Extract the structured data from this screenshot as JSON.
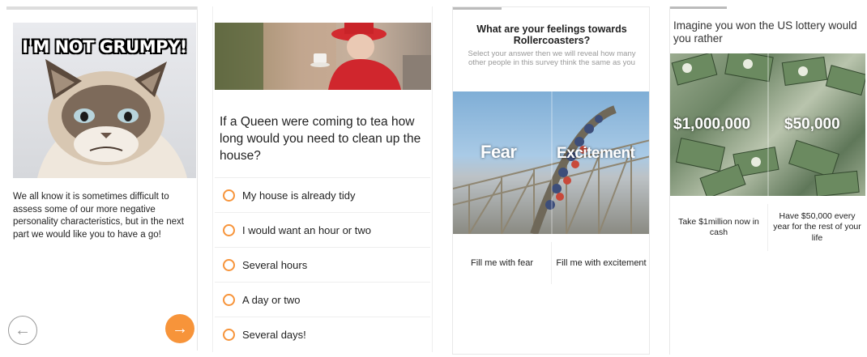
{
  "screen1": {
    "meme_caption": "I'M NOT GRUMPY!",
    "intro_text": "We all know it is sometimes difficult to assess some of our more negative personality characteristics, but in the next part we would like you to have a go!",
    "back_icon": "arrow-left-icon",
    "next_icon": "arrow-right-icon",
    "accent": "#f7943a"
  },
  "screen2": {
    "question": "If a Queen were coming to tea how long would you need to clean up the house?",
    "options": [
      "My house is already tidy",
      "I would want an hour or two",
      "Several hours",
      "A day or two",
      "Several days!"
    ]
  },
  "screen3": {
    "title": "What are your feelings towards Rollercoasters?",
    "subtitle": "Select your answer then we will reveal how many other people in this survey think the same as you",
    "overlay_left": "Fear",
    "overlay_right": "Excitement",
    "choices": [
      "Fill me with fear",
      "Fill me with excitement"
    ]
  },
  "screen4": {
    "question": "Imagine you won the US lottery would you rather",
    "amount_left": "$1,000,000",
    "amount_right": "$50,000",
    "choices": [
      "Take $1million now in cash",
      "Have $50,000 every year for the rest of your life"
    ]
  }
}
